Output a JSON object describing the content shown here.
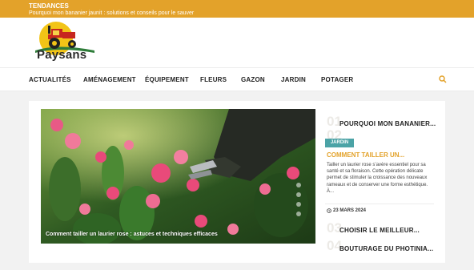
{
  "topbar": {
    "label": "TENDANCES",
    "ticker": "Pourquoi mon bananier jaunit : solutions et conseils pour le sauver"
  },
  "brand": {
    "name": "Paysans"
  },
  "nav": {
    "items": [
      "ACTUALITÉS",
      "AMÉNAGEMENT",
      "ÉQUIPEMENT",
      "FLEURS",
      "GAZON",
      "JARDIN",
      "POTAGER"
    ],
    "search_icon": "search-icon"
  },
  "hero": {
    "caption": "Comment tailler un laurier rose : astuces et techniques efficaces"
  },
  "sidebar": {
    "items": [
      {
        "num": "01",
        "title": "POURQUOI MON BANANIER..."
      },
      {
        "num": "02",
        "title": "COMMENT TAILLER UN..."
      },
      {
        "num": "03",
        "title": "CHOISIR LE MEILLEUR..."
      },
      {
        "num": "04",
        "title": "BOUTURAGE DU PHOTINIA..."
      }
    ],
    "active": {
      "category": "JARDIN",
      "excerpt": "Tailler un laurier rose s’avère essentiel pour sa santé et sa floraison. Cette opération délicate permet de stimuler la croissance des nouveaux rameaux et de conserver une forme esthétique. À...",
      "date": "23 MARS 2024"
    }
  },
  "colors": {
    "accent": "#e3a22a",
    "badge": "#4ba3a6"
  }
}
